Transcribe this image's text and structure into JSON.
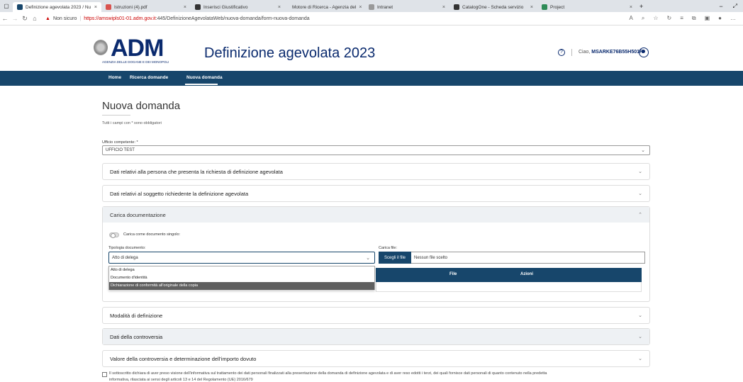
{
  "browser": {
    "tabs": [
      {
        "title": "Definizione agevolata 2023 / Nu",
        "color": "#17466b",
        "active": true
      },
      {
        "title": "Istruzioni (4).pdf",
        "color": "#d9534f",
        "active": false
      },
      {
        "title": "Inserisci Giustificativo",
        "color": "#333333",
        "active": false
      },
      {
        "title": "Motore di Ricerca - Agenzia del",
        "color": "#17466b",
        "active": false
      },
      {
        "title": "Intranet",
        "color": "#999999",
        "active": false
      },
      {
        "title": "CatalogOne - Scheda servizio",
        "color": "#333333",
        "active": false
      },
      {
        "title": "Project",
        "color": "#2e8b57",
        "active": false
      }
    ],
    "security_label": "Non sicuro",
    "url_host": "https://amswipls01-01.adm.gov.it",
    "url_path": ":445/DefinizioneAgevolataWeb/nuova-domanda/form-nuova-domanda"
  },
  "header": {
    "logo": "ADM",
    "logo_sub": "AGENZIA DELLE DOGANE E DEI MONOPOLI",
    "app_title": "Definizione agevolata 2023",
    "greeting": "Ciao,",
    "user": "MSARKE76B55H501R"
  },
  "nav": {
    "items": [
      "Home",
      "Ricerca domande",
      "Nuova domanda"
    ]
  },
  "page": {
    "title": "Nuova domanda",
    "required_note": "Tutti i campi con * sono obbligatori",
    "office_label": "Ufficio competente: *",
    "office_value": "UFFICIO TEST"
  },
  "panels": [
    "Dati relativi alla persona che presenta la richiesta di definizione agevolata",
    "Dati relativi al soggetto richiedente la definizione agevolata",
    "Carica documentazione",
    "Modalità di definizione",
    "Dati della controversia",
    "Valore della controversia e determinazione dell'importo dovuto"
  ],
  "upload": {
    "single_doc_label": "Carica come documento singolo:",
    "doctype_label": "Tipologia documento:",
    "doctype_value": "Atto di delega",
    "file_label": "Carica file:",
    "choose_button": "Scegli il file",
    "no_file": "Nessun file scelto",
    "table_columns": [
      "File",
      "Azioni"
    ],
    "dropdown_options": [
      "Atto di delega",
      "Documento d'identità",
      "Dichiarazione di conformità all'originale della copia"
    ],
    "selected_option_index": 2
  },
  "consent": {
    "line1": "Il sottoscritto dichiara di aver preso visione dell'informativa sul trattamento dei dati personali finalizzati alla presentazione della domanda di definizione agevolata e di aver reso edotti i terzi, dei quali fornisce dati personali di quanto contenuto nella predetta",
    "line2": "informativa, rilasciata ai sensi degli articoli 13 e 14 del Regolamento (UE) 2016/679"
  },
  "colors": {
    "primary": "#17466b",
    "brand_text": "#0a2a6e",
    "warning": "#cc0000"
  }
}
